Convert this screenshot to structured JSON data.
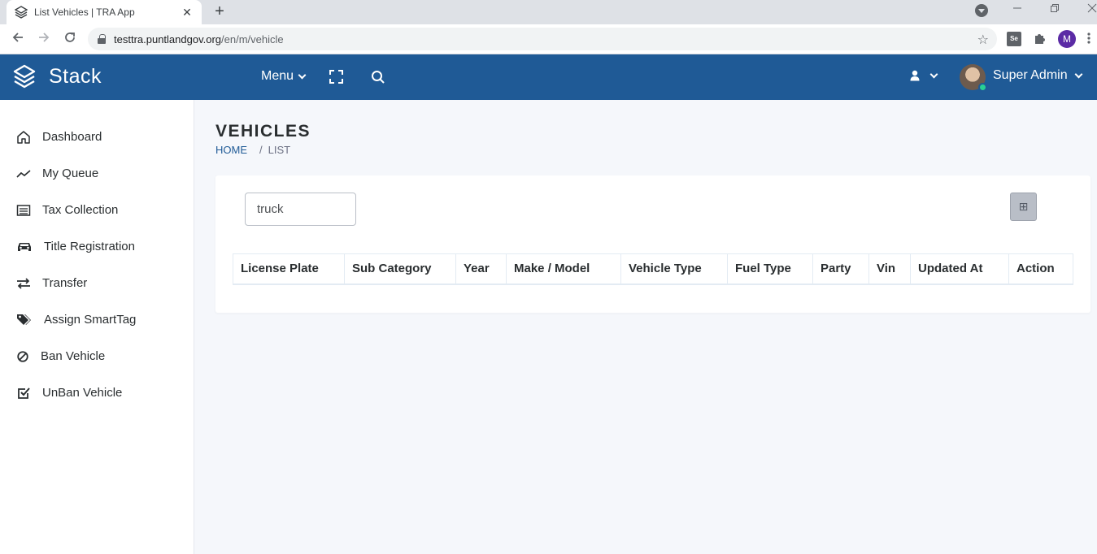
{
  "browser": {
    "tab_title": "List Vehicles | TRA App",
    "tab_close": "✕",
    "new_tab": "+",
    "url_host": "testtra.puntlandgov.org",
    "url_path": "/en/m/vehicle",
    "profile_initial": "M",
    "ext_label": "Se"
  },
  "header": {
    "brand": "Stack",
    "menu_label": "Menu",
    "user_name": "Super Admin"
  },
  "sidebar": {
    "items": [
      {
        "label": "Dashboard",
        "icon": "home-icon"
      },
      {
        "label": "My Queue",
        "icon": "trend-icon"
      },
      {
        "label": "Tax Collection",
        "icon": "list-icon"
      },
      {
        "label": "Title Registration",
        "icon": "car-icon"
      },
      {
        "label": "Transfer",
        "icon": "exchange-icon"
      },
      {
        "label": "Assign SmartTag",
        "icon": "tags-icon"
      },
      {
        "label": "Ban Vehicle",
        "icon": "ban-icon"
      },
      {
        "label": "UnBan Vehicle",
        "icon": "check-square-icon"
      }
    ]
  },
  "page": {
    "title": "VEHICLES",
    "breadcrumb_home": "HOME",
    "breadcrumb_sep": "/",
    "breadcrumb_current": "LIST"
  },
  "search": {
    "value": "truck",
    "placeholder": ""
  },
  "add_button": {
    "icon": "plus-square-icon",
    "glyph": "⊞"
  },
  "table": {
    "columns": [
      "License Plate",
      "Sub Category",
      "Year",
      "Make / Model",
      "Vehicle Type",
      "Fuel Type",
      "Party",
      "Vin",
      "Updated At",
      "Action"
    ],
    "rows": []
  },
  "colors": {
    "header_bg": "#1f5a96",
    "content_bg": "#f5f7fb",
    "online": "#28d094"
  }
}
